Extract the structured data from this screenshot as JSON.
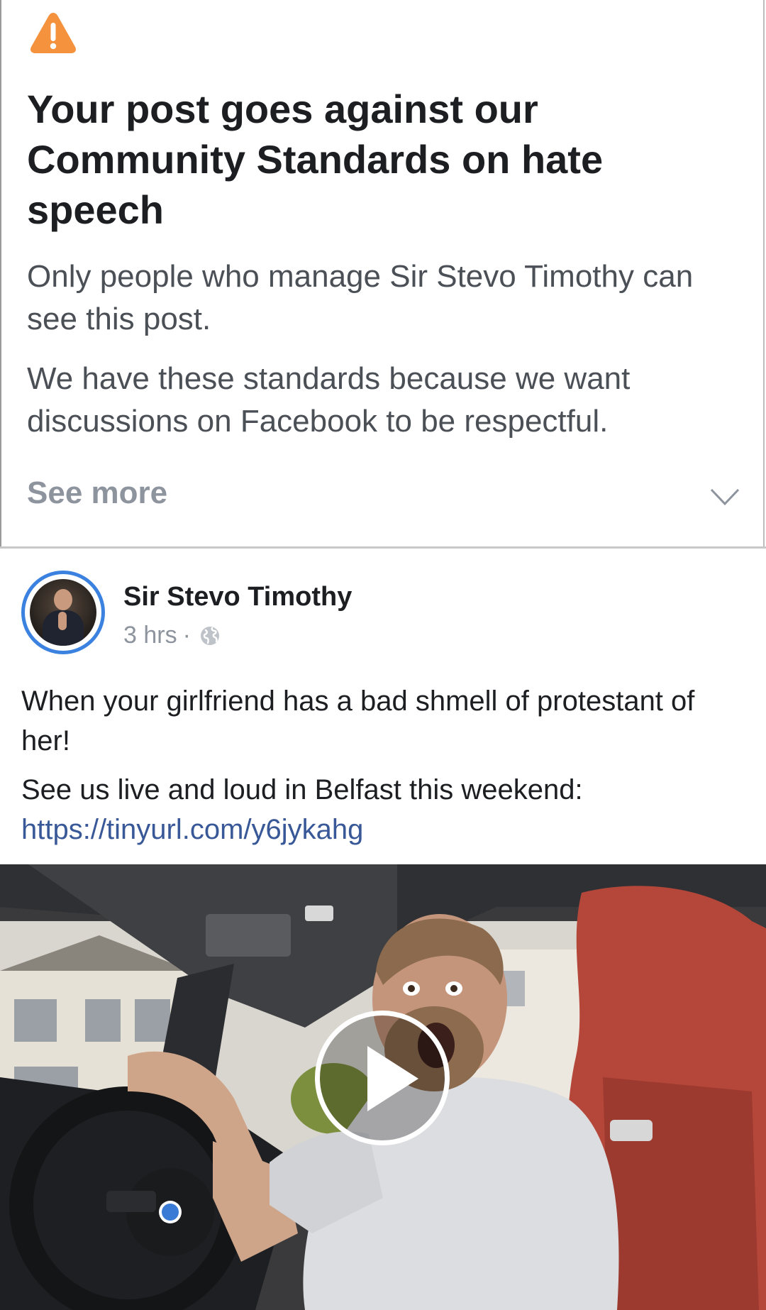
{
  "notice": {
    "title": "Your post goes against our Community Standards on hate speech",
    "paragraph_1": "Only people who manage Sir Stevo Timothy can see this post.",
    "paragraph_2": "We have these standards because we want discussions on Facebook to be respectful.",
    "see_more_label": "See more",
    "icons": {
      "warning": "warning-triangle-icon",
      "expand": "chevron-down-icon"
    },
    "colors": {
      "warning": "#f5923e",
      "divider": "#c8c8c8"
    }
  },
  "post": {
    "author": "Sir Stevo Timothy",
    "time": "3 hrs",
    "separator": "·",
    "audience_icon": "globe-icon",
    "text_line_1": "When your girlfriend has a bad shmell of protestant of her!",
    "text_line_2": "See us live and loud in Belfast this weekend:",
    "link": "https://tinyurl.com/y6jykahg",
    "video": {
      "play_icon": "play-icon"
    },
    "colors": {
      "avatar_ring": "#3b82e0",
      "link": "#385898"
    }
  }
}
